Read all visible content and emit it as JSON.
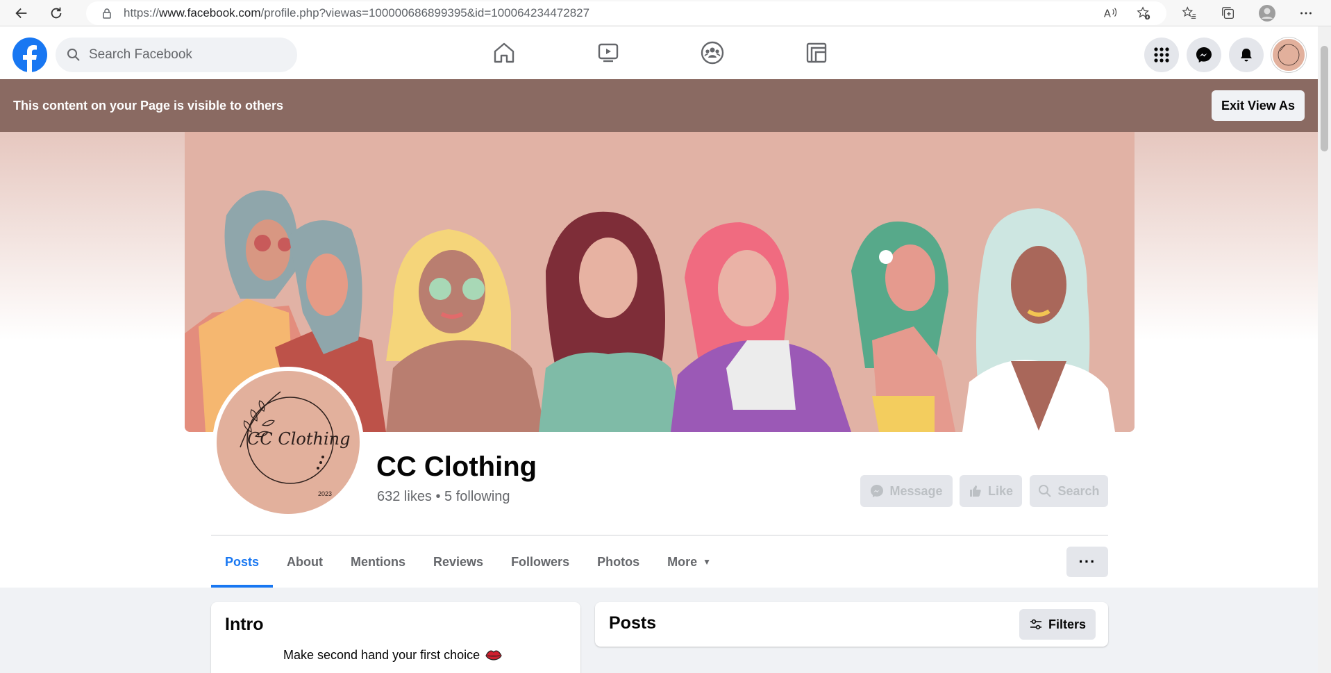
{
  "browser": {
    "url_prefix": "https://",
    "url_host": "www.facebook.com",
    "url_path": "/profile.php?viewas=100000686899395&id=100064234472827"
  },
  "topbar": {
    "search_placeholder": "Search Facebook"
  },
  "banner": {
    "text": "This content on your Page is visible to others",
    "exit_label": "Exit View As"
  },
  "profile": {
    "name": "CC Clothing",
    "stats": "632 likes • 5 following",
    "avatar_text": "CC Clothing",
    "avatar_year": "2023"
  },
  "actions": {
    "message": "Message",
    "like": "Like",
    "search": "Search"
  },
  "tabs": [
    {
      "label": "Posts",
      "active": true
    },
    {
      "label": "About"
    },
    {
      "label": "Mentions"
    },
    {
      "label": "Reviews"
    },
    {
      "label": "Followers"
    },
    {
      "label": "Photos"
    },
    {
      "label": "More"
    }
  ],
  "more_button": "···",
  "intro": {
    "title": "Intro",
    "bio": "Make second hand your first choice"
  },
  "posts": {
    "title": "Posts",
    "filters": "Filters"
  },
  "colors": {
    "fb_blue": "#1877f2",
    "banner": "#8a6a62",
    "cover": "#e1b2a5"
  }
}
